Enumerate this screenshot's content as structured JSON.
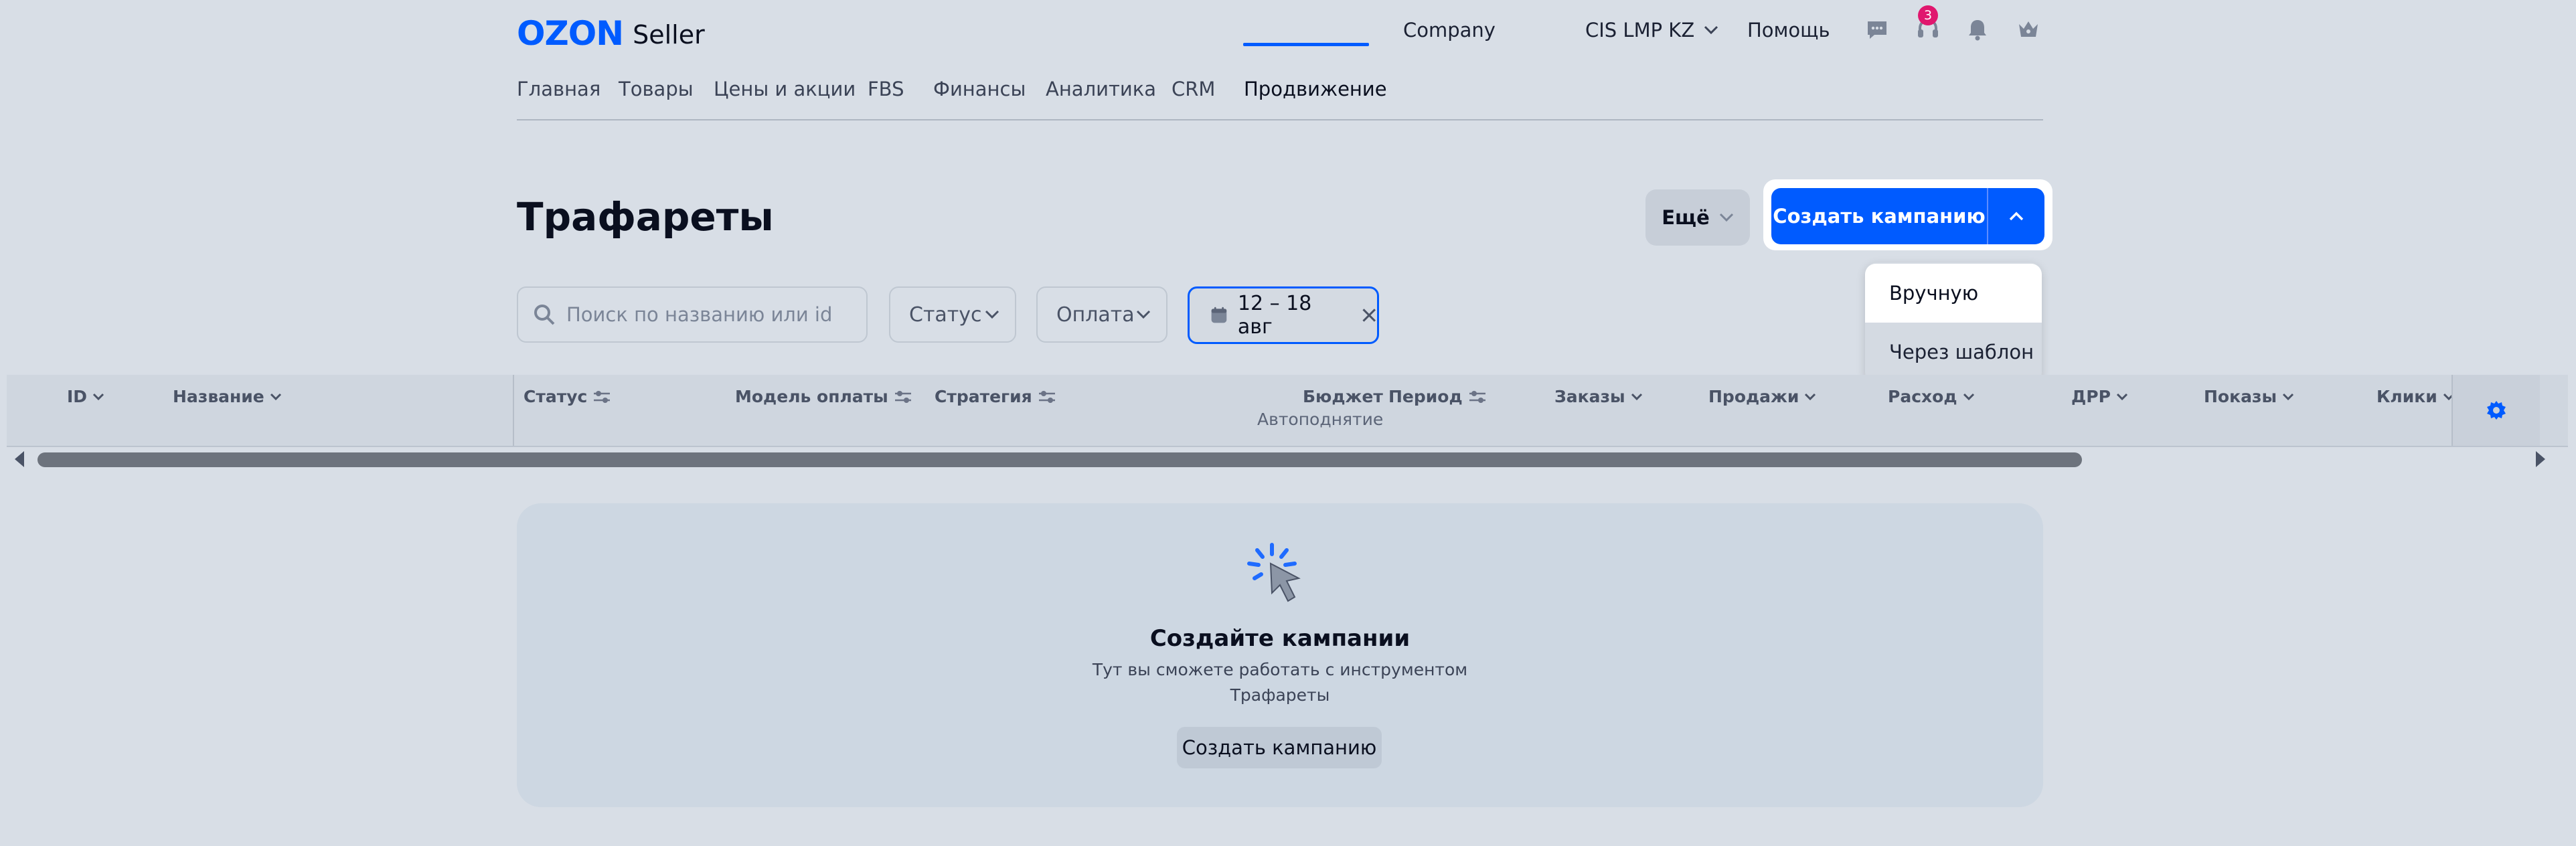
{
  "header": {
    "logo_brand": "OZON",
    "logo_product": "Seller",
    "company_label": "Company",
    "account_label": "CIS LMP KZ",
    "help_label": "Помощь",
    "notification_count": "3"
  },
  "nav": {
    "items": [
      {
        "label": "Главная"
      },
      {
        "label": "Товары"
      },
      {
        "label": "Цены и акции"
      },
      {
        "label": "FBS"
      },
      {
        "label": "Финансы"
      },
      {
        "label": "Аналитика"
      },
      {
        "label": "CRM"
      },
      {
        "label": "Продвижение",
        "active": true
      }
    ]
  },
  "page": {
    "title": "Трафареты",
    "more_label": "Ещё",
    "create_label": "Создать кампанию"
  },
  "dropdown": {
    "items": [
      {
        "label": "Вручную"
      },
      {
        "label": "Через шаблон"
      }
    ]
  },
  "filters": {
    "search_placeholder": "Поиск по названию или id",
    "status_label": "Статус",
    "payment_label": "Оплата",
    "date_range": "12 – 18 авг"
  },
  "table": {
    "columns": [
      {
        "label": "ID"
      },
      {
        "label": "Название"
      },
      {
        "label": "Статус"
      },
      {
        "label": "Модель оплаты"
      },
      {
        "label": "Стратегия"
      },
      {
        "label": "Бюджет",
        "sub": "Автоподнятие"
      },
      {
        "label": "Период"
      },
      {
        "label": "Заказы"
      },
      {
        "label": "Продажи"
      },
      {
        "label": "Расход"
      },
      {
        "label": "ДРР"
      },
      {
        "label": "Показы"
      },
      {
        "label": "Клики"
      }
    ]
  },
  "empty_state": {
    "title": "Создайте кампании",
    "description_line1": "Тут вы сможете работать с инструментом",
    "description_line2": "Трафареты",
    "button_label": "Создать кампанию"
  },
  "colors": {
    "brand": "#005bff",
    "badge": "#e0176e",
    "overlay_background": "#d8dee6"
  }
}
